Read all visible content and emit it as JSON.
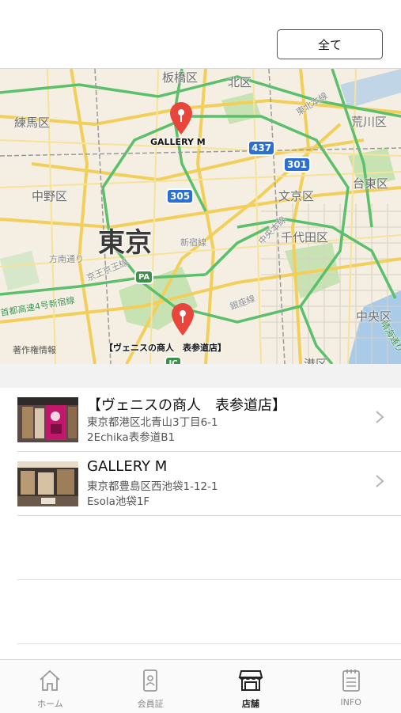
{
  "header": {
    "filter_label": "全て"
  },
  "map": {
    "labels": {
      "itabashi": "板橋区",
      "kita": "北区",
      "nerima": "練馬区",
      "arakawa": "荒川区",
      "nakano": "中野区",
      "bunkyo": "文京区",
      "taito": "台東区",
      "tokyo": "東京",
      "chiyoda": "千代田区",
      "chuo": "中央区",
      "minato": "港区",
      "shinjuku_line": "新宿線",
      "hoonan": "方南通り",
      "keio": "京王京王線",
      "shutoko4": "首都高速4号新宿線",
      "ginza": "銀座線",
      "higashikita": "東北本線",
      "chuo_line": "中央本線",
      "harumi": "晴海通り"
    },
    "route_shields": [
      "437",
      "301",
      "305",
      "PA",
      "JC"
    ],
    "pins": [
      {
        "label": "GALLERY M"
      },
      {
        "label": "【ヴェニスの商人　表参道店】"
      }
    ],
    "attribution": "著作権情報"
  },
  "stores": [
    {
      "name": "【ヴェニスの商人　表参道店】",
      "address_line1": "東京都港区北青山3丁目6-1",
      "address_line2": "2Echika表参道B1"
    },
    {
      "name": "GALLERY M",
      "address_line1": "東京都豊島区西池袋1-12-1",
      "address_line2": "Esola池袋1F"
    }
  ],
  "tabbar": {
    "tabs": [
      {
        "label": "ホーム",
        "icon": "home-icon",
        "active": false
      },
      {
        "label": "会員証",
        "icon": "member-card-icon",
        "active": false
      },
      {
        "label": "店舗",
        "icon": "store-icon",
        "active": true
      },
      {
        "label": "INFO",
        "icon": "info-document-icon",
        "active": false
      }
    ]
  },
  "colors": {
    "pin": "#e8453c",
    "route_shield": "#2a6fd1",
    "map_bg": "#f4efe2",
    "park": "#c7e3b3"
  }
}
